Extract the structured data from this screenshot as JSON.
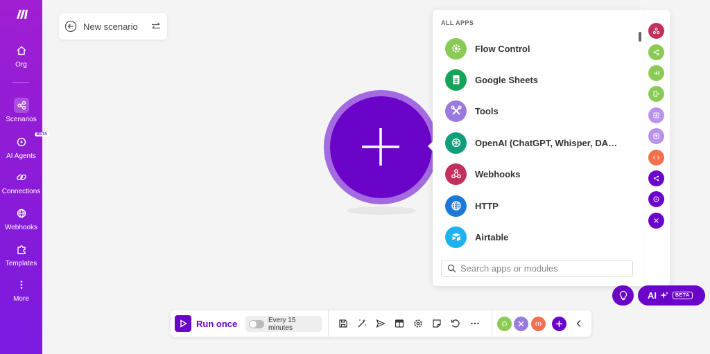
{
  "sidebar": {
    "items": [
      {
        "label": "Org",
        "icon": "home-icon"
      },
      {
        "label": "Scenarios",
        "icon": "share-nodes-icon"
      },
      {
        "label": "AI Agents",
        "icon": "ai-agent-icon",
        "badge": "BETA"
      },
      {
        "label": "Connections",
        "icon": "link-icon"
      },
      {
        "label": "Webhooks",
        "icon": "globe-icon"
      },
      {
        "label": "Templates",
        "icon": "puzzle-icon"
      },
      {
        "label": "More",
        "icon": "more-vertical-icon"
      }
    ]
  },
  "scenario": {
    "title": "New scenario"
  },
  "picker": {
    "heading": "ALL APPS",
    "apps": [
      {
        "name": "Flow Control",
        "color": "#8bcb55"
      },
      {
        "name": "Google Sheets",
        "color": "#16a35a"
      },
      {
        "name": "Tools",
        "color": "#9a7ae0"
      },
      {
        "name": "OpenAI (ChatGPT, Whisper, DALL...",
        "color": "#0f9d7a"
      },
      {
        "name": "Webhooks",
        "color": "#c3305b"
      },
      {
        "name": "HTTP",
        "color": "#1b7ad6"
      },
      {
        "name": "Airtable",
        "color": "#1eb2ee"
      }
    ],
    "search_placeholder": "Search apps or modules"
  },
  "strip_colors": [
    "#c3305b",
    "#8bcb55",
    "#8bcb55",
    "#8bcb55",
    "#b993e9",
    "#b993e9",
    "#f4704e",
    "#6a04c9",
    "#6a04c9",
    "#6a04c9"
  ],
  "toolbar": {
    "run_label": "Run once",
    "schedule_label": "Every 15 minutes"
  },
  "ai": {
    "label": "AI",
    "badge": "BETA"
  },
  "colors": {
    "accent": "#6a04c9",
    "sidebar": "#8a1bd8"
  }
}
